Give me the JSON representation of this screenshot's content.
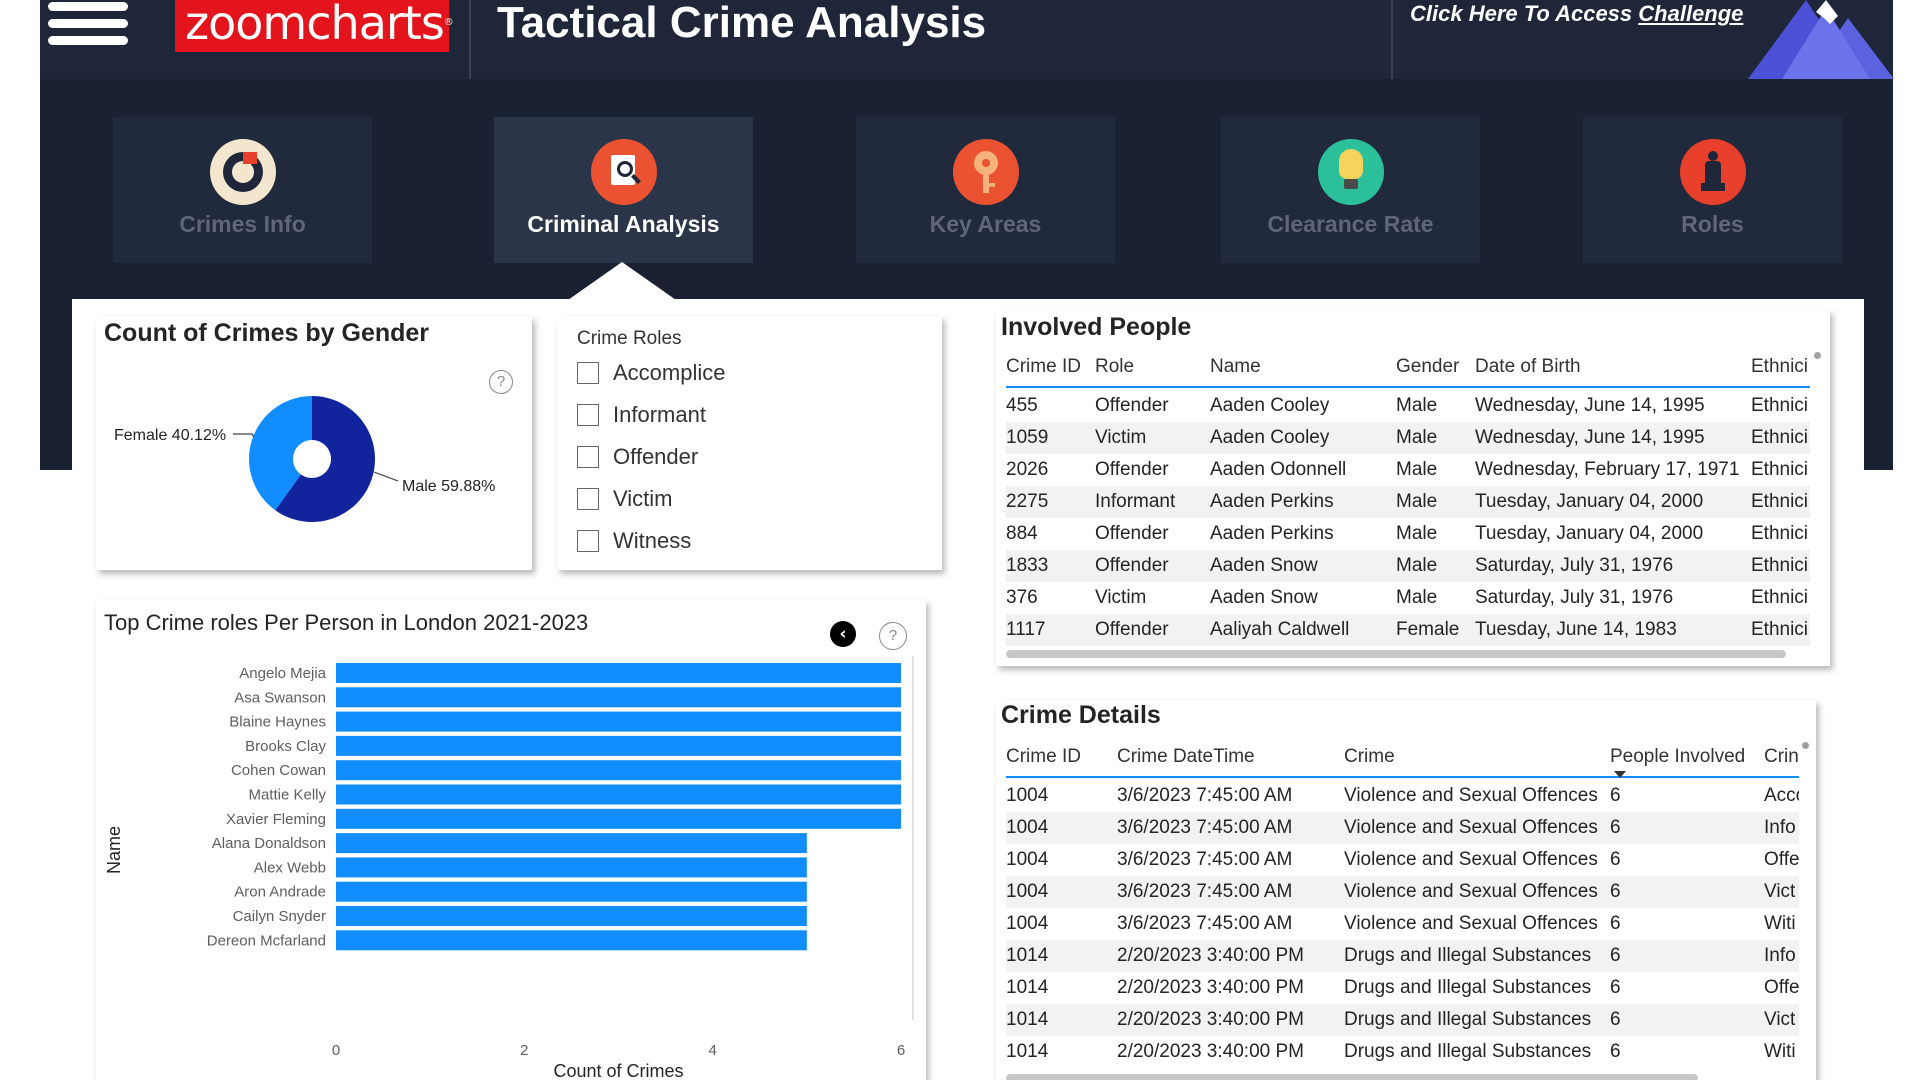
{
  "header": {
    "logo_text": "zoomcharts",
    "title": "Tactical Crime Analysis",
    "challenge_prefix": "Click Here To Access ",
    "challenge_link": "Challenge"
  },
  "nav": {
    "tabs": [
      {
        "label": "Crimes Info",
        "icon": "target-donut-icon",
        "color": "#f2e6cf",
        "active": false
      },
      {
        "label": "Criminal Analysis",
        "icon": "magnifier-document-icon",
        "color": "#ea5232",
        "active": true
      },
      {
        "label": "Key Areas",
        "icon": "key-icon",
        "color": "#ea5232",
        "active": false
      },
      {
        "label": "Clearance Rate",
        "icon": "lightbulb-icon",
        "color": "#2bbf9a",
        "active": false
      },
      {
        "label": "Roles",
        "icon": "chess-piece-icon",
        "color": "#e8402b",
        "active": false
      }
    ]
  },
  "gender_card": {
    "title": "Count of Crimes by Gender",
    "help": "?",
    "female_label": "Female 40.12%",
    "male_label": "Male 59.88%"
  },
  "roles_slicer": {
    "title": "Crime Roles",
    "items": [
      "Accomplice",
      "Informant",
      "Offender",
      "Victim",
      "Witness"
    ]
  },
  "bar_card": {
    "title": "Top Crime roles Per Person in London 2021-2023",
    "help": "?",
    "back": "‹"
  },
  "involved_people": {
    "title": "Involved People",
    "columns": [
      "Crime ID",
      "Role",
      "Name",
      "Gender",
      "Date of Birth",
      "Ethnici"
    ],
    "rows": [
      [
        "455",
        "Offender",
        "Aaden Cooley",
        "Male",
        "Wednesday, June 14, 1995",
        "Ethnici"
      ],
      [
        "1059",
        "Victim",
        "Aaden Cooley",
        "Male",
        "Wednesday, June 14, 1995",
        "Ethnici"
      ],
      [
        "2026",
        "Offender",
        "Aaden Odonnell",
        "Male",
        "Wednesday, February 17, 1971",
        "Ethnici"
      ],
      [
        "2275",
        "Informant",
        "Aaden Perkins",
        "Male",
        "Tuesday, January 04, 2000",
        "Ethnici"
      ],
      [
        "884",
        "Offender",
        "Aaden Perkins",
        "Male",
        "Tuesday, January 04, 2000",
        "Ethnici"
      ],
      [
        "1833",
        "Offender",
        "Aaden Snow",
        "Male",
        "Saturday, July 31, 1976",
        "Ethnici"
      ],
      [
        "376",
        "Victim",
        "Aaden Snow",
        "Male",
        "Saturday, July 31, 1976",
        "Ethnici"
      ],
      [
        "1117",
        "Offender",
        "Aaliyah Caldwell",
        "Female",
        "Tuesday, June 14, 1983",
        "Ethnici"
      ]
    ]
  },
  "crime_details": {
    "title": "Crime Details",
    "columns": [
      "Crime ID",
      "Crime DateTime",
      "Crime",
      "People Involved",
      "Crin"
    ],
    "rows": [
      [
        "1004",
        "3/6/2023 7:45:00 AM",
        "Violence and Sexual Offences",
        "6",
        "Acco"
      ],
      [
        "1004",
        "3/6/2023 7:45:00 AM",
        "Violence and Sexual Offences",
        "6",
        "Info"
      ],
      [
        "1004",
        "3/6/2023 7:45:00 AM",
        "Violence and Sexual Offences",
        "6",
        "Offe"
      ],
      [
        "1004",
        "3/6/2023 7:45:00 AM",
        "Violence and Sexual Offences",
        "6",
        "Vict"
      ],
      [
        "1004",
        "3/6/2023 7:45:00 AM",
        "Violence and Sexual Offences",
        "6",
        "Witi"
      ],
      [
        "1014",
        "2/20/2023 3:40:00 PM",
        "Drugs and Illegal Substances",
        "6",
        "Info"
      ],
      [
        "1014",
        "2/20/2023 3:40:00 PM",
        "Drugs and Illegal Substances",
        "6",
        "Offe"
      ],
      [
        "1014",
        "2/20/2023 3:40:00 PM",
        "Drugs and Illegal Substances",
        "6",
        "Vict"
      ],
      [
        "1014",
        "2/20/2023 3:40:00 PM",
        "Drugs and Illegal Substances",
        "6",
        "Witi"
      ]
    ]
  },
  "colors": {
    "female": "#118dff",
    "male": "#12239e",
    "bar": "#118dff"
  },
  "chart_data": [
    {
      "type": "pie",
      "title": "Count of Crimes by Gender",
      "categories": [
        "Female",
        "Male"
      ],
      "values": [
        40.12,
        59.88
      ],
      "labels": [
        "Female 40.12%",
        "Male 59.88%"
      ]
    },
    {
      "type": "bar",
      "orientation": "horizontal",
      "title": "Top Crime roles Per Person in London 2021-2023",
      "xlabel": "Count of Crimes",
      "ylabel": "Name",
      "xlim": [
        0,
        6
      ],
      "xticks": [
        "0",
        "2",
        "4",
        "6"
      ],
      "categories": [
        "Angelo Mejia",
        "Asa Swanson",
        "Blaine Haynes",
        "Brooks Clay",
        "Cohen Cowan",
        "Mattie Kelly",
        "Xavier Fleming",
        "Alana Donaldson",
        "Alex Webb",
        "Aron Andrade",
        "Cailyn Snyder",
        "Dereon Mcfarland"
      ],
      "values": [
        6,
        6,
        6,
        6,
        6,
        6,
        6,
        5,
        5,
        5,
        5,
        5
      ]
    }
  ]
}
